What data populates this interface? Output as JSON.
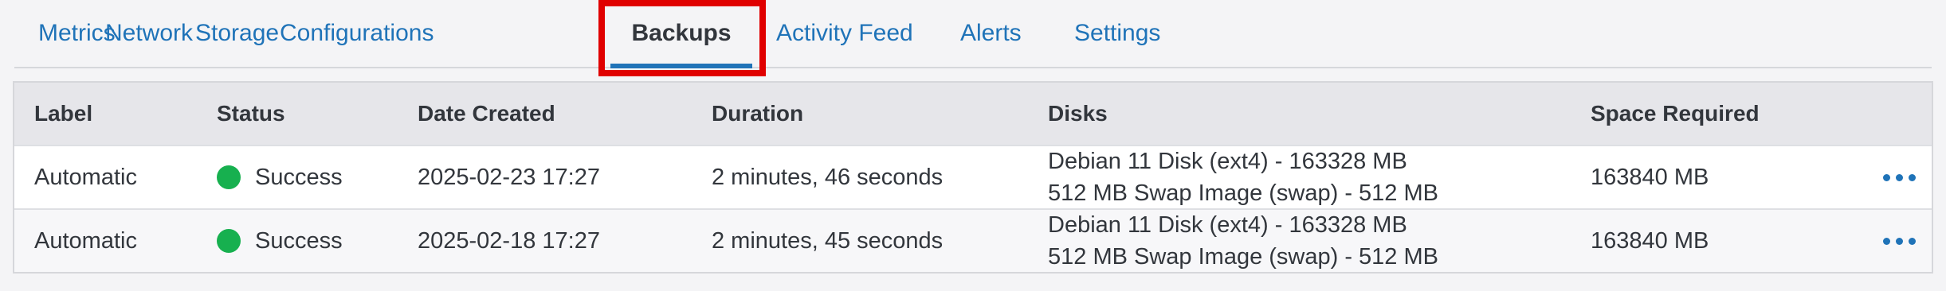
{
  "tabs": [
    {
      "label": "Metrics"
    },
    {
      "label": "Network"
    },
    {
      "label": "Storage"
    },
    {
      "label": "Configurations"
    },
    {
      "label": "Backups",
      "active": true
    },
    {
      "label": "Activity Feed"
    },
    {
      "label": "Alerts"
    },
    {
      "label": "Settings"
    }
  ],
  "table": {
    "headers": [
      "Label",
      "Status",
      "Date Created",
      "Duration",
      "Disks",
      "Space Required"
    ],
    "rows": [
      {
        "label": "Automatic",
        "status": "Success",
        "date_created": "2025-02-23 17:27",
        "duration": "2 minutes, 46 seconds",
        "disks": [
          "Debian 11 Disk (ext4) - 163328 MB",
          "512 MB Swap Image (swap) - 512 MB"
        ],
        "space_required": "163840 MB"
      },
      {
        "label": "Automatic",
        "status": "Success",
        "date_created": "2025-02-18 17:27",
        "duration": "2 minutes, 45 seconds",
        "disks": [
          "Debian 11 Disk (ext4) - 163328 MB",
          "512 MB Swap Image (swap) - 512 MB"
        ],
        "space_required": "163840 MB"
      }
    ]
  },
  "colors": {
    "accent": "#1f73b8",
    "success": "#17b04f",
    "highlight": "#e00000"
  }
}
